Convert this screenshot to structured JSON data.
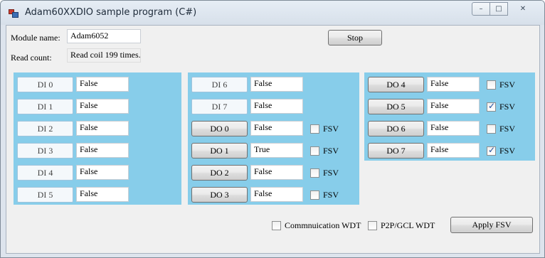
{
  "window": {
    "title": "Adam60XXDIO sample program (C#)",
    "minimize_glyph": "–",
    "maximize_glyph": "□",
    "close_glyph": "✕"
  },
  "module": {
    "name_label": "Module name:",
    "name_value": "Adam6052",
    "read_label": "Read count:",
    "read_value": "Read coil 199 times.",
    "stop_label": "Stop"
  },
  "fsv_label": "FSV",
  "panel1": [
    {
      "label": "DI 0",
      "value": "False"
    },
    {
      "label": "DI 1",
      "value": "False"
    },
    {
      "label": "DI 2",
      "value": "False"
    },
    {
      "label": "DI 3",
      "value": "False"
    },
    {
      "label": "DI 4",
      "value": "False"
    },
    {
      "label": "DI 5",
      "value": "False"
    }
  ],
  "panel2": [
    {
      "label": "DI 6",
      "value": "False"
    },
    {
      "label": "DI 7",
      "value": "False"
    },
    {
      "label": "DO 0",
      "value": "False",
      "fsv": false
    },
    {
      "label": "DO 1",
      "value": "True",
      "fsv": false
    },
    {
      "label": "DO 2",
      "value": "False",
      "fsv": false
    },
    {
      "label": "DO 3",
      "value": "False",
      "fsv": false
    }
  ],
  "panel3": [
    {
      "label": "DO 4",
      "value": "False",
      "fsv": false
    },
    {
      "label": "DO 5",
      "value": "False",
      "fsv": true
    },
    {
      "label": "DO 6",
      "value": "False",
      "fsv": false
    },
    {
      "label": "DO 7",
      "value": "False",
      "fsv": true
    }
  ],
  "bottom": {
    "comm_wdt_label": "Commnuication WDT",
    "comm_wdt_checked": false,
    "p2p_wdt_label": "P2P/GCL WDT",
    "p2p_wdt_checked": false,
    "apply_label": "Apply FSV"
  },
  "colors": {
    "panel": "#87cdea",
    "form": "#f0f0f0",
    "title_bar": "#dde4ed"
  }
}
